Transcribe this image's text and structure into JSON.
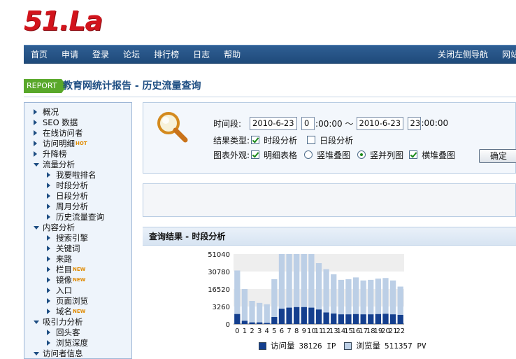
{
  "logo": {
    "text": "51.La"
  },
  "nav": {
    "left": [
      "首页",
      "申请",
      "登录",
      "论坛",
      "排行榜",
      "日志",
      "帮助"
    ],
    "right": [
      "关闭左侧导航",
      "网站"
    ]
  },
  "report": {
    "tag": "REPORT",
    "title": "教育网统计报告 - 历史流量查询"
  },
  "sidebar": {
    "items": [
      {
        "label": "概况",
        "level": 0,
        "arrow": "right",
        "badge": ""
      },
      {
        "label": "SEO 数据",
        "level": 0,
        "arrow": "right",
        "badge": ""
      },
      {
        "label": "在线访问者",
        "level": 0,
        "arrow": "right",
        "badge": ""
      },
      {
        "label": "访问明细",
        "level": 0,
        "arrow": "right",
        "badge": "HOT"
      },
      {
        "label": "升降榜",
        "level": 0,
        "arrow": "right",
        "badge": ""
      },
      {
        "label": "流量分析",
        "level": 0,
        "arrow": "down",
        "badge": ""
      },
      {
        "label": "我要啦排名",
        "level": 1,
        "arrow": "right",
        "badge": ""
      },
      {
        "label": "时段分析",
        "level": 1,
        "arrow": "right",
        "badge": ""
      },
      {
        "label": "日段分析",
        "level": 1,
        "arrow": "right",
        "badge": ""
      },
      {
        "label": "周月分析",
        "level": 1,
        "arrow": "right",
        "badge": ""
      },
      {
        "label": "历史流量查询",
        "level": 1,
        "arrow": "right",
        "badge": ""
      },
      {
        "label": "内容分析",
        "level": 0,
        "arrow": "down",
        "badge": ""
      },
      {
        "label": "搜索引擎",
        "level": 1,
        "arrow": "right",
        "badge": ""
      },
      {
        "label": "关键词",
        "level": 1,
        "arrow": "right",
        "badge": ""
      },
      {
        "label": "来路",
        "level": 1,
        "arrow": "right",
        "badge": ""
      },
      {
        "label": "栏目",
        "level": 1,
        "arrow": "right",
        "badge": "NEW"
      },
      {
        "label": "镜像",
        "level": 1,
        "arrow": "right",
        "badge": "NEW"
      },
      {
        "label": "入口",
        "level": 1,
        "arrow": "right",
        "badge": ""
      },
      {
        "label": "页面浏览",
        "level": 1,
        "arrow": "right",
        "badge": ""
      },
      {
        "label": "域名",
        "level": 1,
        "arrow": "right",
        "badge": "NEW"
      },
      {
        "label": "吸引力分析",
        "level": 0,
        "arrow": "down",
        "badge": ""
      },
      {
        "label": "回头客",
        "level": 1,
        "arrow": "right",
        "badge": ""
      },
      {
        "label": "浏览深度",
        "level": 1,
        "arrow": "right",
        "badge": ""
      },
      {
        "label": "访问者信息",
        "level": 0,
        "arrow": "down",
        "badge": ""
      }
    ]
  },
  "query": {
    "period_label": "时间段:",
    "start_date": "2010-6-23",
    "start_hour": "0",
    "start_suffix": ":00:00 ～",
    "end_date": "2010-6-23",
    "end_hour": "23",
    "end_suffix": ":00:00",
    "result_type_label": "结果类型:",
    "type_hourly": "时段分析",
    "type_daily": "日段分析",
    "appearance_label": "图表外观:",
    "opt_detail_table": "明细表格",
    "opt_vertical_stacked": "竖堆叠图",
    "opt_vertical_column": "竖并列图",
    "opt_horizontal_stacked": "横堆叠图",
    "ok_button": "确定"
  },
  "result": {
    "title": "查询结果 - 时段分析"
  },
  "chart_data": {
    "type": "bar",
    "categories": [
      "0",
      "1",
      "2",
      "3",
      "4",
      "5",
      "6",
      "7",
      "8",
      "9",
      "10",
      "11",
      "12",
      "13",
      "14",
      "15",
      "16",
      "17",
      "18",
      "19",
      "20",
      "21",
      "22"
    ],
    "series": [
      {
        "name": "访问量",
        "values": [
          1860,
          600,
          300,
          300,
          200,
          1300,
          2850,
          3050,
          3150,
          3150,
          3050,
          2700,
          2150,
          1950,
          1800,
          1800,
          1850,
          1800,
          1800,
          1850,
          1900,
          1800,
          1700
        ]
      },
      {
        "name": "浏览量",
        "values": [
          32000,
          16500,
          7500,
          6000,
          5000,
          24500,
          53000,
          60500,
          63500,
          61500,
          51000,
          40500,
          33500,
          28500,
          24000,
          24500,
          26000,
          23500,
          24000,
          25000,
          25500,
          23500,
          18500
        ]
      }
    ],
    "yticks": [
      "0",
      "3260",
      "16520",
      "30780",
      "51040"
    ],
    "legend": [
      {
        "name": "访问量",
        "total": "38126 IP",
        "color": "#143f8e"
      },
      {
        "name": "浏览量",
        "total": "511357 PV",
        "color": "#bccfe6"
      }
    ],
    "legend_placement": "bottom"
  },
  "colors": {
    "nav_bg": "#1f4a7a",
    "accent": "#1d4d82",
    "report_tag": "#59a82a",
    "logo_red": "#d2141c",
    "bar_dark": "#143f8e",
    "bar_light": "#bccfe6"
  }
}
